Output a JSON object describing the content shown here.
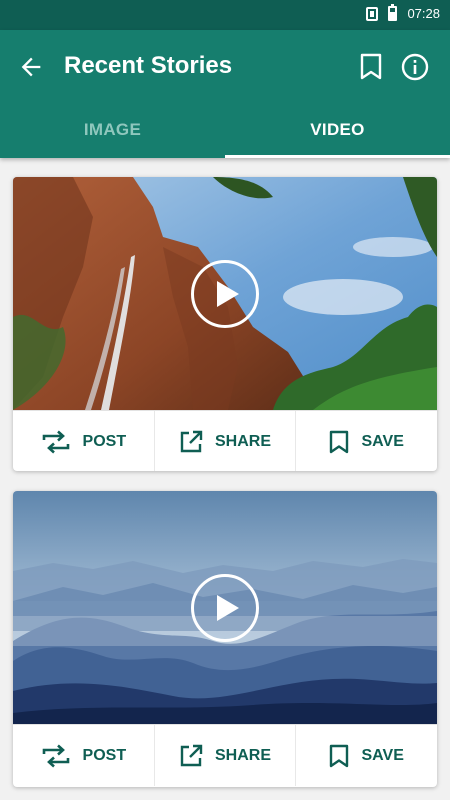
{
  "status_bar": {
    "time": "07:28"
  },
  "appbar": {
    "title": "Recent Stories",
    "back_icon": "arrow-left-icon",
    "bookmark_icon": "bookmark-icon",
    "info_icon": "info-icon"
  },
  "tabs": [
    {
      "label": "IMAGE",
      "active": false
    },
    {
      "label": "VIDEO",
      "active": true
    }
  ],
  "cards": [
    {
      "media_type": "video",
      "actions": [
        {
          "label": "POST",
          "icon": "repost-icon"
        },
        {
          "label": "SHARE",
          "icon": "share-icon"
        },
        {
          "label": "SAVE",
          "icon": "bookmark-icon"
        }
      ]
    },
    {
      "media_type": "video",
      "actions": [
        {
          "label": "POST",
          "icon": "repost-icon"
        },
        {
          "label": "SHARE",
          "icon": "share-icon"
        },
        {
          "label": "SAVE",
          "icon": "bookmark-icon"
        }
      ]
    }
  ],
  "colors": {
    "status_bar": "#0f5e53",
    "primary": "#167e6e",
    "accent_text": "#0f5e53",
    "inactive_tab": "#8fc7bd"
  }
}
